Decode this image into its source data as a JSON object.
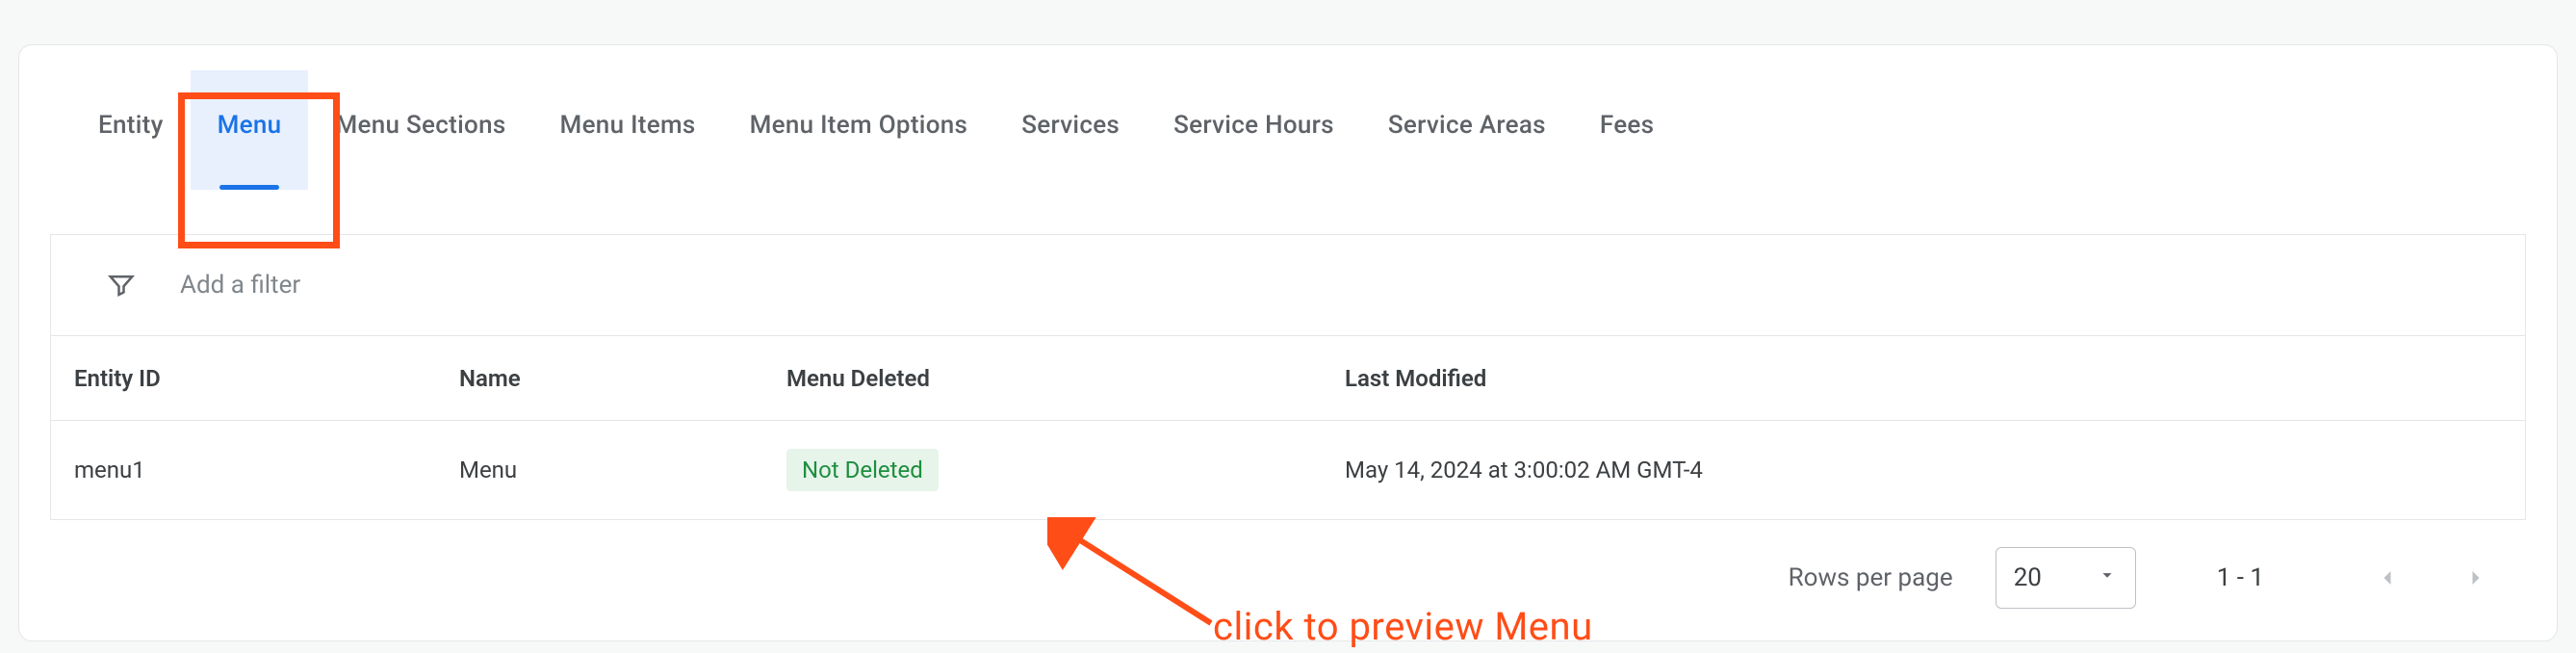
{
  "tabs": [
    {
      "label": "Entity"
    },
    {
      "label": "Menu"
    },
    {
      "label": "Menu Sections"
    },
    {
      "label": "Menu Items"
    },
    {
      "label": "Menu Item Options"
    },
    {
      "label": "Services"
    },
    {
      "label": "Service Hours"
    },
    {
      "label": "Service Areas"
    },
    {
      "label": "Fees"
    }
  ],
  "active_tab_index": 1,
  "filter": {
    "placeholder": "Add a filter"
  },
  "columns": {
    "entity_id": "Entity ID",
    "name": "Name",
    "menu_deleted": "Menu Deleted",
    "last_modified": "Last Modified"
  },
  "rows": [
    {
      "entity_id": "menu1",
      "name": "Menu",
      "deleted_badge": "Not Deleted",
      "last_modified": "May 14, 2024 at 3:00:02 AM GMT-4"
    }
  ],
  "pagination": {
    "rows_per_page_label": "Rows per page",
    "rows_per_page_value": "20",
    "range_text": "1 - 1"
  },
  "annotation": {
    "text": "click to preview Menu"
  },
  "colors": {
    "accent": "#1a73e8",
    "highlight": "#ff4d17",
    "badge_bg": "#e6f4ea",
    "badge_fg": "#1e8e3e"
  }
}
